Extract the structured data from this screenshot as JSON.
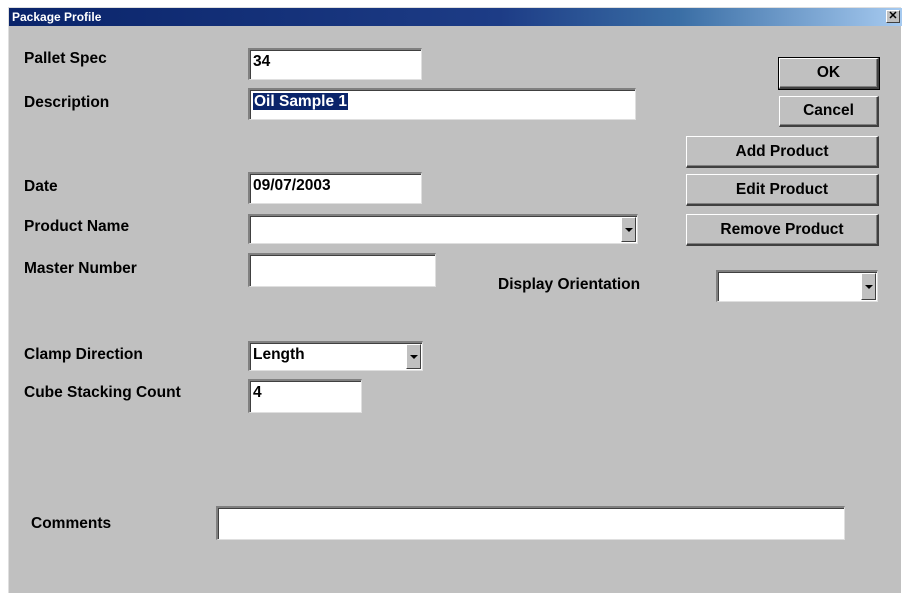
{
  "window": {
    "title": "Package Profile",
    "close_glyph": "✕"
  },
  "fields": {
    "pallet_spec": {
      "label": "Pallet Spec",
      "value": "34"
    },
    "description": {
      "label": "Description",
      "value": "Oil Sample 1"
    },
    "date": {
      "label": "Date",
      "value": "09/07/2003"
    },
    "product_name": {
      "label": "Product Name",
      "value": ""
    },
    "master_number": {
      "label": "Master Number",
      "value": ""
    },
    "display_orientation": {
      "label": "Display Orientation",
      "value": ""
    },
    "clamp_direction": {
      "label": "Clamp Direction",
      "value": "Length"
    },
    "cube_stacking_count": {
      "label": "Cube Stacking Count",
      "value": "4"
    },
    "comments": {
      "label": "Comments",
      "value": ""
    }
  },
  "buttons": {
    "ok": "OK",
    "cancel": "Cancel",
    "add_product": "Add Product",
    "edit_product": "Edit Product",
    "remove_product": "Remove Product"
  }
}
